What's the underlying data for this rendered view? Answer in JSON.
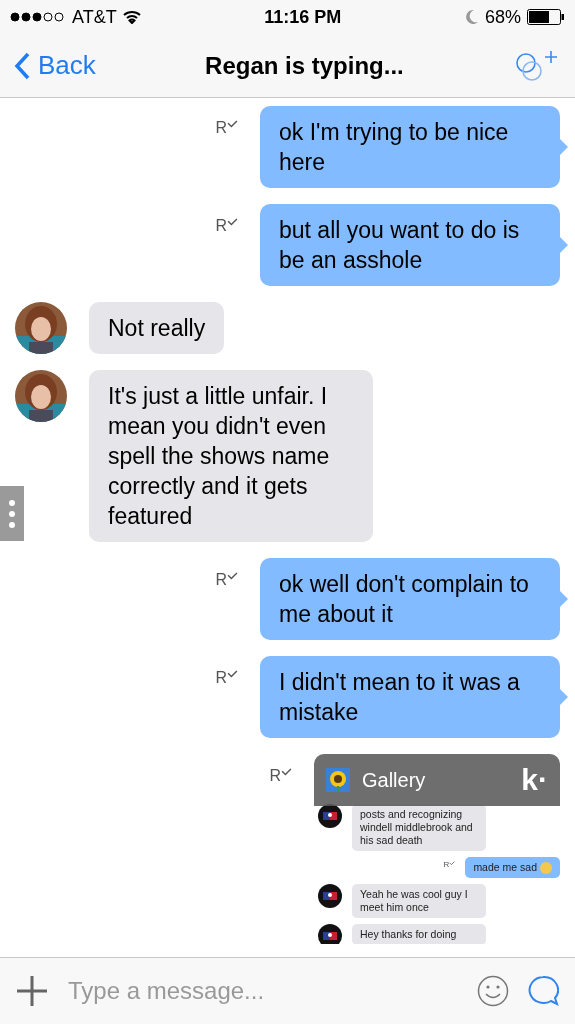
{
  "status_bar": {
    "carrier": "AT&T",
    "time": "11:16 PM",
    "battery": "68%"
  },
  "nav": {
    "back": "Back",
    "title": "Regan is typing..."
  },
  "messages": [
    {
      "kind": "sent",
      "text": "ok I'm trying to be nice here",
      "receipt": "R"
    },
    {
      "kind": "sent",
      "text": "but all you want to do is be an asshole",
      "receipt": "R"
    },
    {
      "kind": "received",
      "text": "Not really"
    },
    {
      "kind": "received",
      "text": "It's just a little unfair. I mean you didn't even spell the shows name correctly and it gets featured"
    },
    {
      "kind": "sent",
      "text": "ok well don't complain to me about it",
      "receipt": "R"
    },
    {
      "kind": "sent",
      "text": "I didn't mean to it was a mistake",
      "receipt": "R"
    },
    {
      "kind": "screenshot",
      "receipt": "R",
      "banner": {
        "label": "Gallery",
        "logo": "k·"
      },
      "items": [
        {
          "kind": "received",
          "text": "posts and recognizing windell middlebrook and his sad death"
        },
        {
          "kind": "sent",
          "text": "made me sad",
          "receipt": "R"
        },
        {
          "kind": "received",
          "text": "Yeah he was cool guy I meet him once"
        },
        {
          "kind": "received",
          "text": "Hey thanks for doing"
        }
      ]
    }
  ],
  "composer": {
    "placeholder": "Type a message..."
  }
}
